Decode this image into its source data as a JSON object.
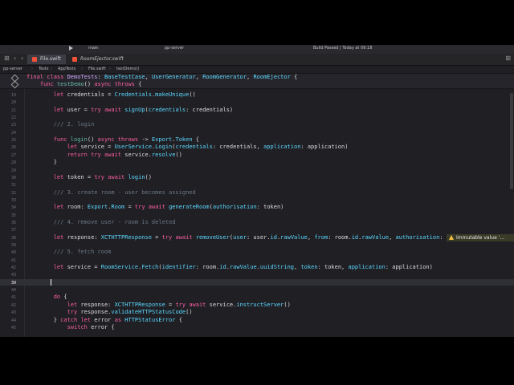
{
  "toolbar": {
    "scheme_label": "main",
    "project_label": "pp-server",
    "status_text": "Build Passed | Today at 09:18"
  },
  "tabs": [
    {
      "label": "File.swift",
      "active": true
    },
    {
      "label": "RoomEjector.swift",
      "active": false
    }
  ],
  "breadcrumb": [
    "pp-server",
    "Tests",
    "AppTests",
    "File.swift",
    "testDemo()"
  ],
  "editor": {
    "sticky": [
      [
        {
          "t": "final class ",
          "c": "kw"
        },
        {
          "t": "DemoTests",
          "c": "ty"
        },
        {
          "t": ": ",
          "c": "pl"
        },
        {
          "t": "BaseTestCase",
          "c": "tp"
        },
        {
          "t": ", ",
          "c": "pl"
        },
        {
          "t": "UserGenerator",
          "c": "tp"
        },
        {
          "t": ", ",
          "c": "pl"
        },
        {
          "t": "RoomGenerator",
          "c": "tp"
        },
        {
          "t": ", ",
          "c": "pl"
        },
        {
          "t": "RoomEjector",
          "c": "tp"
        },
        {
          "t": " {",
          "c": "pl"
        }
      ],
      [
        {
          "t": "    func ",
          "c": "kw"
        },
        {
          "t": "testDemo",
          "c": "fn"
        },
        {
          "t": "() ",
          "c": "pl"
        },
        {
          "t": "async throws",
          "c": "kw"
        },
        {
          "t": " {",
          "c": "pl"
        }
      ]
    ],
    "lines": [
      {
        "num": "19",
        "tokens": [
          {
            "t": "        ",
            "c": "pl"
          },
          {
            "t": "let",
            "c": "kw"
          },
          {
            "t": " credentials = ",
            "c": "pl"
          },
          {
            "t": "Credentials",
            "c": "tp"
          },
          {
            "t": ".",
            "c": "pl"
          },
          {
            "t": "makeUnique",
            "c": "tp"
          },
          {
            "t": "()",
            "c": "pl"
          }
        ]
      },
      {
        "num": "20",
        "tokens": []
      },
      {
        "num": "21",
        "tokens": [
          {
            "t": "        ",
            "c": "pl"
          },
          {
            "t": "let",
            "c": "kw"
          },
          {
            "t": " user = ",
            "c": "pl"
          },
          {
            "t": "try await",
            "c": "kw"
          },
          {
            "t": " ",
            "c": "pl"
          },
          {
            "t": "signUp",
            "c": "tp"
          },
          {
            "t": "(",
            "c": "pl"
          },
          {
            "t": "credentials",
            "c": "tp"
          },
          {
            "t": ": credentials)",
            "c": "pl"
          }
        ]
      },
      {
        "num": "22",
        "tokens": []
      },
      {
        "num": "23",
        "tokens": [
          {
            "t": "        /// 2. login",
            "c": "cm"
          }
        ]
      },
      {
        "num": "24",
        "tokens": []
      },
      {
        "num": "25",
        "tokens": [
          {
            "t": "        ",
            "c": "pl"
          },
          {
            "t": "func",
            "c": "kw"
          },
          {
            "t": " ",
            "c": "pl"
          },
          {
            "t": "login",
            "c": "fn"
          },
          {
            "t": "() ",
            "c": "pl"
          },
          {
            "t": "async throws",
            "c": "kw"
          },
          {
            "t": " -> ",
            "c": "pl"
          },
          {
            "t": "Export",
            "c": "tp"
          },
          {
            "t": ".",
            "c": "pl"
          },
          {
            "t": "Token",
            "c": "tp"
          },
          {
            "t": " {",
            "c": "pl"
          }
        ]
      },
      {
        "num": "26",
        "tokens": [
          {
            "t": "            ",
            "c": "pl"
          },
          {
            "t": "let",
            "c": "kw"
          },
          {
            "t": " service = ",
            "c": "pl"
          },
          {
            "t": "UserService",
            "c": "tp"
          },
          {
            "t": ".",
            "c": "pl"
          },
          {
            "t": "Login",
            "c": "tp"
          },
          {
            "t": "(",
            "c": "pl"
          },
          {
            "t": "credentials",
            "c": "tp"
          },
          {
            "t": ": credentials, ",
            "c": "pl"
          },
          {
            "t": "application",
            "c": "tp"
          },
          {
            "t": ": application)",
            "c": "pl"
          }
        ]
      },
      {
        "num": "27",
        "tokens": [
          {
            "t": "            ",
            "c": "pl"
          },
          {
            "t": "return try await",
            "c": "kw"
          },
          {
            "t": " service.",
            "c": "pl"
          },
          {
            "t": "resolve",
            "c": "tp"
          },
          {
            "t": "()",
            "c": "pl"
          }
        ]
      },
      {
        "num": "28",
        "tokens": [
          {
            "t": "        }",
            "c": "pl"
          }
        ]
      },
      {
        "num": "29",
        "tokens": []
      },
      {
        "num": "30",
        "tokens": [
          {
            "t": "        ",
            "c": "pl"
          },
          {
            "t": "let",
            "c": "kw"
          },
          {
            "t": " token = ",
            "c": "pl"
          },
          {
            "t": "try await",
            "c": "kw"
          },
          {
            "t": " ",
            "c": "pl"
          },
          {
            "t": "login",
            "c": "tp"
          },
          {
            "t": "()",
            "c": "pl"
          }
        ]
      },
      {
        "num": "31",
        "tokens": []
      },
      {
        "num": "32",
        "tokens": [
          {
            "t": "        /// 3. create room - user becomes assigned",
            "c": "cm"
          }
        ]
      },
      {
        "num": "33",
        "tokens": []
      },
      {
        "num": "34",
        "tokens": [
          {
            "t": "        ",
            "c": "pl"
          },
          {
            "t": "let",
            "c": "kw"
          },
          {
            "t": " room: ",
            "c": "pl"
          },
          {
            "t": "Export",
            "c": "tp"
          },
          {
            "t": ".",
            "c": "pl"
          },
          {
            "t": "Room",
            "c": "tp"
          },
          {
            "t": " = ",
            "c": "pl"
          },
          {
            "t": "try await",
            "c": "kw"
          },
          {
            "t": " ",
            "c": "pl"
          },
          {
            "t": "generateRoom",
            "c": "tp"
          },
          {
            "t": "(",
            "c": "pl"
          },
          {
            "t": "authorisation",
            "c": "tp"
          },
          {
            "t": ": token)",
            "c": "pl"
          }
        ]
      },
      {
        "num": "35",
        "tokens": []
      },
      {
        "num": "36",
        "tokens": [
          {
            "t": "        /// 4. remove user - room is deleted",
            "c": "cm"
          }
        ]
      },
      {
        "num": "37",
        "tokens": []
      },
      {
        "num": "38",
        "issue": true,
        "tokens": [
          {
            "t": "        ",
            "c": "pl"
          },
          {
            "t": "let",
            "c": "kw"
          },
          {
            "t": " response: ",
            "c": "pl"
          },
          {
            "t": "XCTHTTPResponse",
            "c": "tp"
          },
          {
            "t": " = ",
            "c": "pl"
          },
          {
            "t": "try await",
            "c": "kw"
          },
          {
            "t": " ",
            "c": "pl"
          },
          {
            "t": "removeUser",
            "c": "tp"
          },
          {
            "t": "(",
            "c": "pl"
          },
          {
            "t": "user",
            "c": "tp"
          },
          {
            "t": ": user.",
            "c": "pl"
          },
          {
            "t": "id",
            "c": "tp"
          },
          {
            "t": ".",
            "c": "pl"
          },
          {
            "t": "rawValue",
            "c": "tp"
          },
          {
            "t": ", ",
            "c": "pl"
          },
          {
            "t": "from",
            "c": "tp"
          },
          {
            "t": ": room.",
            "c": "pl"
          },
          {
            "t": "id",
            "c": "tp"
          },
          {
            "t": ".",
            "c": "pl"
          },
          {
            "t": "rawValue",
            "c": "tp"
          },
          {
            "t": ", ",
            "c": "pl"
          },
          {
            "t": "authorisation",
            "c": "tp"
          },
          {
            "t": ": token)",
            "c": "pl"
          }
        ]
      },
      {
        "num": "39",
        "tokens": []
      },
      {
        "num": "40",
        "tokens": [
          {
            "t": "        /// 5. fetch room",
            "c": "cm"
          }
        ]
      },
      {
        "num": "41",
        "tokens": []
      },
      {
        "num": "42",
        "tokens": [
          {
            "t": "        ",
            "c": "pl"
          },
          {
            "t": "let",
            "c": "kw"
          },
          {
            "t": " service = ",
            "c": "pl"
          },
          {
            "t": "RoomService",
            "c": "tp"
          },
          {
            "t": ".",
            "c": "pl"
          },
          {
            "t": "Fetch",
            "c": "tp"
          },
          {
            "t": "(",
            "c": "pl"
          },
          {
            "t": "identifier",
            "c": "tp"
          },
          {
            "t": ": room.",
            "c": "pl"
          },
          {
            "t": "id",
            "c": "tp"
          },
          {
            "t": ".",
            "c": "pl"
          },
          {
            "t": "rawValue",
            "c": "tp"
          },
          {
            "t": ".",
            "c": "pl"
          },
          {
            "t": "uuidString",
            "c": "tp"
          },
          {
            "t": ", ",
            "c": "pl"
          },
          {
            "t": "token",
            "c": "tp"
          },
          {
            "t": ": token, ",
            "c": "pl"
          },
          {
            "t": "application",
            "c": "tp"
          },
          {
            "t": ": application)",
            "c": "pl"
          }
        ]
      },
      {
        "num": "43",
        "tokens": []
      },
      {
        "num": "39",
        "current": true,
        "tokens": []
      },
      {
        "num": "40",
        "tokens": []
      },
      {
        "num": "41",
        "tokens": [
          {
            "t": "        ",
            "c": "pl"
          },
          {
            "t": "do",
            "c": "kw"
          },
          {
            "t": " {",
            "c": "pl"
          }
        ]
      },
      {
        "num": "42",
        "tokens": [
          {
            "t": "            ",
            "c": "pl"
          },
          {
            "t": "let",
            "c": "kw"
          },
          {
            "t": " response: ",
            "c": "pl"
          },
          {
            "t": "XCTHTTPResponse",
            "c": "tp"
          },
          {
            "t": " = ",
            "c": "pl"
          },
          {
            "t": "try await",
            "c": "kw"
          },
          {
            "t": " service.",
            "c": "pl"
          },
          {
            "t": "instructServer",
            "c": "tp"
          },
          {
            "t": "()",
            "c": "pl"
          }
        ]
      },
      {
        "num": "43",
        "tokens": [
          {
            "t": "            ",
            "c": "pl"
          },
          {
            "t": "try",
            "c": "kw"
          },
          {
            "t": " response.",
            "c": "pl"
          },
          {
            "t": "validateHTTPStatusCode",
            "c": "tp"
          },
          {
            "t": "()",
            "c": "pl"
          }
        ]
      },
      {
        "num": "44",
        "tokens": [
          {
            "t": "        } ",
            "c": "pl"
          },
          {
            "t": "catch let",
            "c": "kw"
          },
          {
            "t": " error ",
            "c": "pl"
          },
          {
            "t": "as",
            "c": "kw"
          },
          {
            "t": " ",
            "c": "pl"
          },
          {
            "t": "HTTPStatusError",
            "c": "tp"
          },
          {
            "t": " {",
            "c": "pl"
          }
        ]
      },
      {
        "num": "45",
        "tokens": [
          {
            "t": "            ",
            "c": "pl"
          },
          {
            "t": "switch",
            "c": "kw"
          },
          {
            "t": " error {",
            "c": "pl"
          }
        ]
      }
    ]
  },
  "issue_text": "Immutable value '...",
  "colors": {
    "keyword": "#fc5fa3",
    "type": "#5dd8ff",
    "comment": "#6c7986",
    "plain": "#dcdcdc",
    "background": "#1f1f24"
  }
}
